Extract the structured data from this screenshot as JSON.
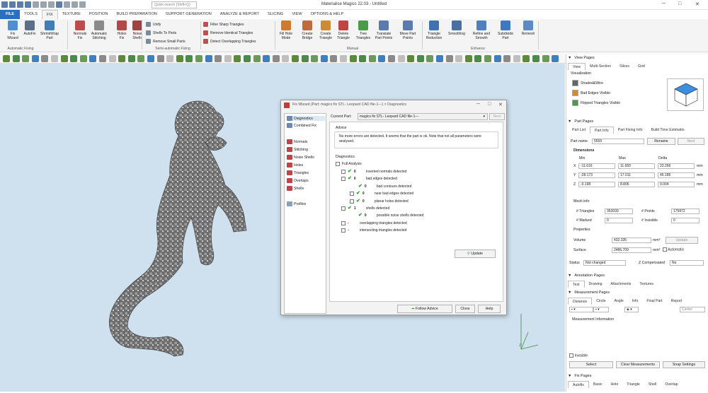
{
  "app": {
    "title": "Materialise Magics 22.03 - Untitled",
    "search_placeholder": "Quick search (Shift+Q)"
  },
  "menu": [
    "FILE",
    "TOOLS",
    "FIX",
    "TEXTURE",
    "POSITION",
    "BUILD PREPARATION",
    "SUPPORT GENERATION",
    "ANALYZE & REPORT",
    "SLICING",
    "VIEW",
    "OPTIONS & HELP"
  ],
  "ribbon": {
    "buttons": [
      {
        "label": "Fix\nWizard",
        "color": "#4d8fd1"
      },
      {
        "label": "AutoFix",
        "color": "#5b6f8a"
      },
      {
        "label": "ShrinkWrap\nPart",
        "color": "#3f7fb8"
      },
      {
        "label": "Normals\nFix",
        "color": "#c04a4a"
      },
      {
        "label": "Automatic\nStitching",
        "color": "#8a8a8a"
      },
      {
        "label": "Holes\nFix",
        "color": "#b34848"
      },
      {
        "label": "Noise\nShells",
        "color": "#a04242"
      },
      {
        "label": "Fill Hole\nMode",
        "color": "#d07a30"
      },
      {
        "label": "Create\nBridge",
        "color": "#c06a40"
      },
      {
        "label": "Create\nTriangle",
        "color": "#d08a35"
      },
      {
        "label": "Delete\nTriangle",
        "color": "#c04444"
      },
      {
        "label": "Tree\nTriangles",
        "color": "#4a9a4a"
      },
      {
        "label": "Translate\nPart Points",
        "color": "#5a7ab0"
      },
      {
        "label": "Move Part\nPoints",
        "color": "#5a7ab0"
      },
      {
        "label": "Triangle\nReduction",
        "color": "#3e72b2"
      },
      {
        "label": "Smoothing",
        "color": "#4a6fa5"
      },
      {
        "label": "Refine and\nSmooth",
        "color": "#4e7fbf"
      },
      {
        "label": "Subdivide\nPart",
        "color": "#3d78c0"
      },
      {
        "label": "Remesh",
        "color": "#5a8ac8"
      }
    ],
    "small": [
      "Unify",
      "Shells To Parts",
      "Remove Small Parts",
      "Filter Sharp Triangles",
      "Remove Identical Triangles",
      "Detect Overlapping Triangles"
    ],
    "groups": [
      "Automatic Fixing",
      "Semi-automatic Fixing",
      "Manual",
      "Enhance"
    ]
  },
  "right_panel": {
    "view_pages": {
      "title": "View Pages",
      "tabs": [
        "View",
        "Multi-Section",
        "Slices",
        "Grid"
      ],
      "visualization": "Visualization",
      "options": [
        "Shaded&Wire",
        "Bad Edges Visible",
        "Flipped Triangles Visible"
      ]
    },
    "part_pages": {
      "title": "Part Pages",
      "tabs": [
        "Part List",
        "Part Info",
        "Part Fixing Info",
        "Build Time Estimatio"
      ],
      "part_name_label": "Part name",
      "part_name": "5555",
      "rename": "Rename",
      "next": "Next",
      "dimensions": "Dimensions",
      "cols": [
        "Min",
        "Max",
        "Delta"
      ],
      "rows": [
        {
          "axis": "X",
          "min": "-11.616",
          "max": "11.650",
          "delta": "23.266",
          "unit": "mm"
        },
        {
          "axis": "Y",
          "min": "-28.173",
          "max": "17.011",
          "delta": "45.185",
          "unit": "mm"
        },
        {
          "axis": "Z",
          "min": "-0.198",
          "max": "8.806",
          "delta": "9.004",
          "unit": "mm"
        }
      ],
      "mesh_info": "Mesh info",
      "triangles_label": "# Triangles",
      "triangles": "353030",
      "points_label": "# Points",
      "points": "175872",
      "marked_label": "# Marked",
      "marked": "0",
      "invisible_label": "# Invisible",
      "invisible": "0",
      "properties": "Properties",
      "volume_label": "Volume",
      "volume": "432.335",
      "volume_unit": "mm³",
      "update": "Update",
      "surface_label": "Surface",
      "surface": "2486.709",
      "surface_unit": "mm²",
      "automatic": "Automatic",
      "status_label": "Status",
      "status": "Not changed",
      "zcomp_label": "Z Compensated",
      "zcomp": "No"
    },
    "annotation_pages": {
      "title": "Annotation Pages",
      "tabs": [
        "Text",
        "Drawing",
        "Attachments",
        "Textures"
      ]
    },
    "measurement_pages": {
      "title": "Measurement Pages",
      "tabs": [
        "Distance",
        "Circle",
        "Angle",
        "Info",
        "Final Part",
        "Report"
      ],
      "center": "Center",
      "info": "Measurement Information",
      "invisible": "Invisible",
      "buttons": [
        "Select",
        "Clear Measurements",
        "Snap Settings"
      ]
    },
    "fix_pages": {
      "title": "Fix Pages",
      "tabs": [
        "Autofix",
        "Basic",
        "Hole",
        "Triangle",
        "Shell",
        "Overlap"
      ]
    }
  },
  "dialog": {
    "title": "Fix Wizard (Part: magics fix STL- Leopard CAD file-1---) > Diagnostics",
    "nav": [
      "Diagnostics",
      "Combined Fix",
      "Normals",
      "Stitching",
      "Noise Shells",
      "Holes",
      "Triangles",
      "Overlaps",
      "Shells",
      "Profiles"
    ],
    "current_part_label": "Current Part:",
    "current_part": "magics fix STL- Leopard CAD file-1---",
    "next": "Next",
    "advice_label": "Advice",
    "advice": "No more errors are detected. It seems that the part is ok. Note that not all parameters were analysed.",
    "diagnostics_label": "Diagnostics",
    "full_analysis": "Full Analysis",
    "items": [
      {
        "indent": 0,
        "checked": true,
        "ok": true,
        "count": "0",
        "label": "inverted normals detected"
      },
      {
        "indent": 0,
        "checked": true,
        "ok": true,
        "count": "0",
        "label": "bad edges detected"
      },
      {
        "indent": 2,
        "checked": false,
        "ok": true,
        "count": "0",
        "label": "bad contours detected"
      },
      {
        "indent": 1,
        "checked": true,
        "ok": true,
        "count": "0",
        "label": "near bad edges detected"
      },
      {
        "indent": 1,
        "checked": true,
        "ok": true,
        "count": "0",
        "label": "planar holes detected"
      },
      {
        "indent": 0,
        "checked": true,
        "ok": true,
        "count": "1",
        "label": "shells detected"
      },
      {
        "indent": 2,
        "checked": false,
        "ok": true,
        "count": "0",
        "label": "possible noise shells detected"
      },
      {
        "indent": 0,
        "checked": false,
        "ok": false,
        "count": "-",
        "label": "overlapping triangles detected"
      },
      {
        "indent": 0,
        "checked": false,
        "ok": false,
        "count": "-",
        "label": "intersecting triangles detected"
      }
    ],
    "update": "Update",
    "follow_advice": "Follow Advice",
    "close": "Close",
    "help": "Help"
  },
  "axes": {
    "z": "Z",
    "x": "X",
    "y": "Y"
  }
}
